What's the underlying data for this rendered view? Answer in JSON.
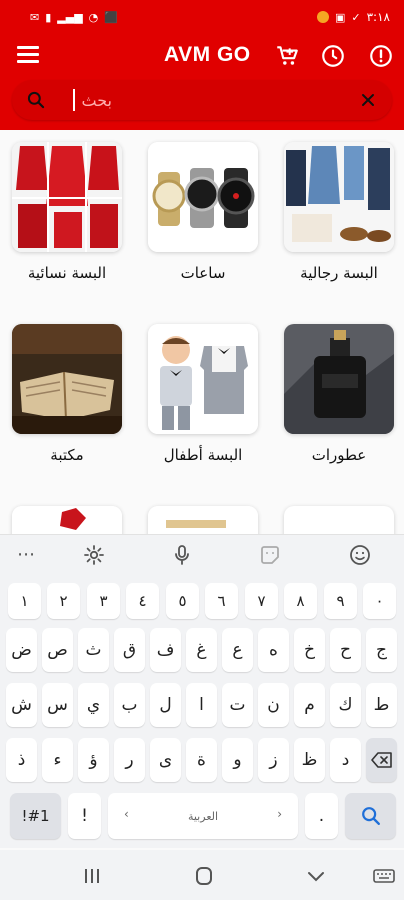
{
  "status_bar": {
    "time": "٣:١٨"
  },
  "header": {
    "title": "AVM GO",
    "menu_icon": "menu-icon",
    "cart_icon": "cart-icon",
    "history_icon": "clock-icon",
    "info_icon": "alert-icon"
  },
  "search": {
    "placeholder": "بحث",
    "value": ""
  },
  "categories": [
    {
      "label": "البسة نسائية",
      "icon": "women-clothing-image"
    },
    {
      "label": "ساعات",
      "icon": "watches-image"
    },
    {
      "label": "البسة رجالية",
      "icon": "men-clothing-image"
    },
    {
      "label": "مكتبة",
      "icon": "library-image"
    },
    {
      "label": "البسة أطفال",
      "icon": "kids-clothing-image"
    },
    {
      "label": "عطورات",
      "icon": "perfume-image"
    }
  ],
  "keyboard": {
    "language_label": "العربية",
    "symbols_label": "!#1",
    "row_numbers": [
      "١",
      "٢",
      "٣",
      "٤",
      "٥",
      "٦",
      "٧",
      "٨",
      "٩",
      "٠"
    ],
    "row1": [
      "ض",
      "ص",
      "ث",
      "ق",
      "ف",
      "غ",
      "ع",
      "ه",
      "خ",
      "ح",
      "ج"
    ],
    "row2": [
      "ش",
      "س",
      "ي",
      "ب",
      "ل",
      "ا",
      "ت",
      "ن",
      "م",
      "ك",
      "ط"
    ],
    "row3": [
      "ذ",
      "ء",
      "ؤ",
      "ر",
      "ى",
      "ة",
      "و",
      "ز",
      "ظ",
      "د"
    ],
    "punct_left": "!",
    "punct_right": "."
  }
}
